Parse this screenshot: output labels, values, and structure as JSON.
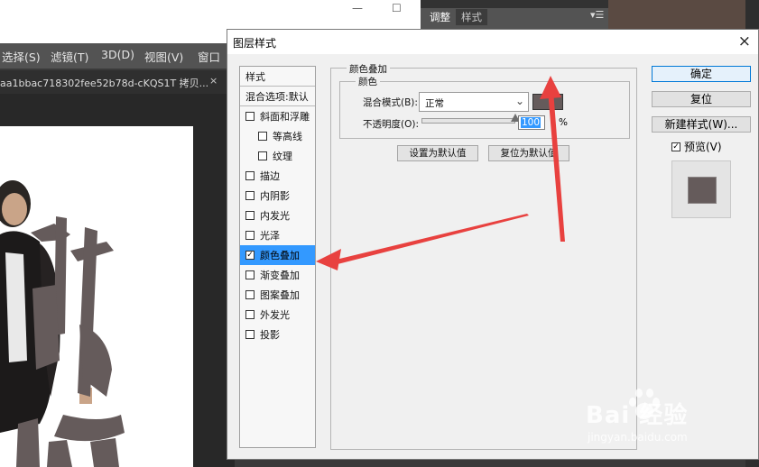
{
  "background": {
    "menu": [
      "选择(S)",
      "滤镜(T)",
      "3D(D)",
      "视图(V)",
      "窗口"
    ],
    "doc_tab_title": "aa1bbac718302fee52b78d-cKQS1T 拷贝...",
    "doc_tab_close": "×",
    "window_controls": [
      "—",
      "☐"
    ],
    "panel_tabs": [
      "调整",
      "样式"
    ]
  },
  "dialog": {
    "title": "图层样式",
    "close": "×",
    "style_list": {
      "header": "样式",
      "blend_options": "混合选项:默认",
      "items": [
        {
          "label": "斜面和浮雕",
          "checked": false,
          "indent": false
        },
        {
          "label": "等高线",
          "checked": false,
          "indent": true
        },
        {
          "label": "纹理",
          "checked": false,
          "indent": true
        },
        {
          "label": "描边",
          "checked": false,
          "indent": false
        },
        {
          "label": "内阴影",
          "checked": false,
          "indent": false
        },
        {
          "label": "内发光",
          "checked": false,
          "indent": false
        },
        {
          "label": "光泽",
          "checked": false,
          "indent": false
        },
        {
          "label": "颜色叠加",
          "checked": true,
          "indent": false
        },
        {
          "label": "渐变叠加",
          "checked": false,
          "indent": false
        },
        {
          "label": "图案叠加",
          "checked": false,
          "indent": false
        },
        {
          "label": "外发光",
          "checked": false,
          "indent": false
        },
        {
          "label": "投影",
          "checked": false,
          "indent": false
        }
      ]
    },
    "section_title": "颜色叠加",
    "subsection_title": "颜色",
    "blend_mode_label": "混合模式(B):",
    "blend_mode_value": "正常",
    "overlay_color": "#655b5b",
    "opacity_label": "不透明度(O):",
    "opacity_value": "100",
    "opacity_unit": "%",
    "opacity_level": 1.0,
    "set_default": "设置为默认值",
    "reset_default": "复位为默认值",
    "ok": "确定",
    "reset": "复位",
    "new_style": "新建样式(W)...",
    "preview_label": "预览(V)",
    "preview_checked": true
  },
  "watermark": {
    "brand": "Bai 经验",
    "url": "jingyan.baidu.com"
  },
  "annotations": {
    "arrow_color": "#e8413f"
  }
}
